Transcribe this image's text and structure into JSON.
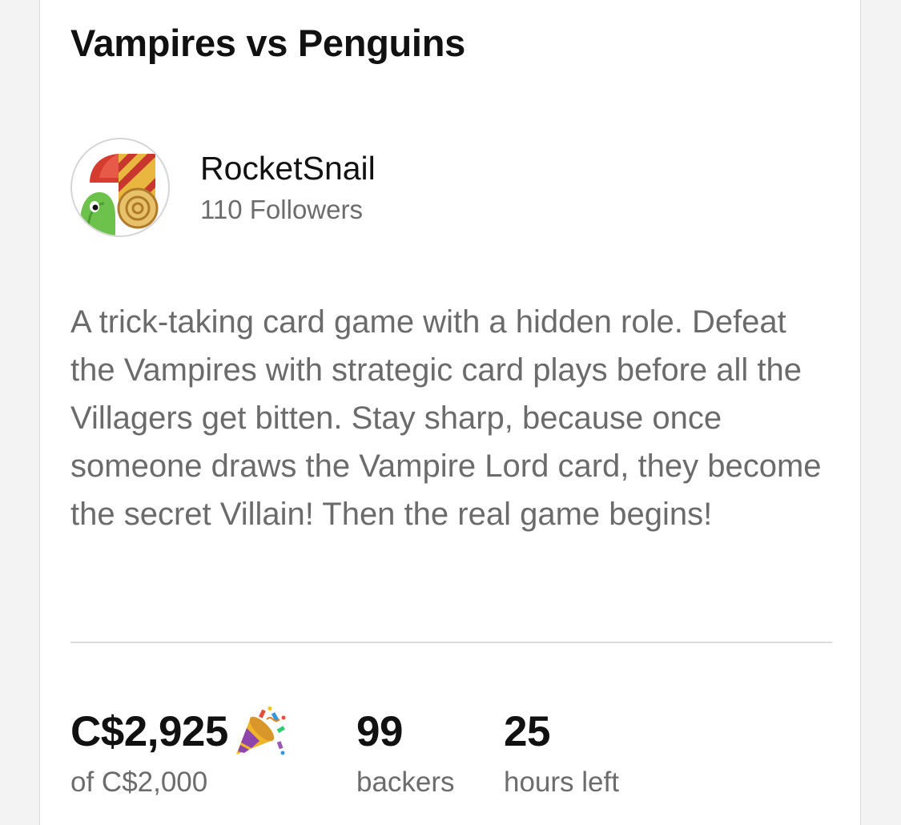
{
  "project": {
    "title": "Vampires vs Penguins"
  },
  "creator": {
    "name": "RocketSnail",
    "followers": "110 Followers",
    "avatar_icon": "rocket-snail-avatar-icon"
  },
  "description": "A trick-taking card game with a hidden role. Defeat the Vampires with strategic card plays before all the Villagers get bitten. Stay sharp, because once someone draws the Vampire Lord card, they become the secret Villain! Then the real game begins!",
  "stats": {
    "pledged": {
      "value": "C$2,925",
      "label": "of C$2,000",
      "icon": "party-popper-icon"
    },
    "backers": {
      "value": "99",
      "label": "backers"
    },
    "time_left": {
      "value": "25",
      "label": "hours left"
    }
  },
  "colors": {
    "text_primary": "#111111",
    "text_secondary": "#6c6c6c",
    "background": "#ffffff",
    "page_background": "#f3f3f3",
    "divider": "#dcdcdc"
  }
}
